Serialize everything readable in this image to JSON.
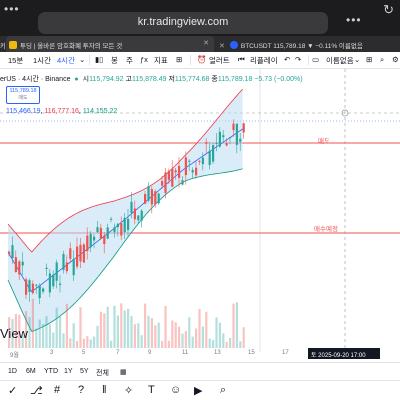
{
  "browser": {
    "url": "kr.tradingview.com",
    "tabs": [
      {
        "label": "카"
      },
      {
        "label": "투딩 | 올바른 암호화폐 투자의 모든 것"
      },
      {
        "label": "BTCUSDT 115,789.18 ▼ −0.11% 이름없음"
      }
    ]
  },
  "toolbar": {
    "intervals": [
      "15분",
      "1시간",
      "4시간"
    ],
    "chart_type": "봉",
    "extra": "주",
    "indicators": "지표",
    "alert": "얼러트",
    "replay": "리플레이",
    "layout_name": "이름없음"
  },
  "legend": {
    "symbol": "erUS · 4시간 · Binance",
    "open_label": "시",
    "open": "115,794.92",
    "high_label": "고",
    "high": "115,878.49",
    "low_label": "저",
    "low": "115,774.68",
    "close_label": "종",
    "close": "115,789.18",
    "change": "−5.73 (−0.00%)",
    "badge_price": "115,789.18",
    "badge_sub": "매도"
  },
  "bb_legend": {
    "basis": "115,466.19",
    "upper": "116,777.16",
    "lower": "114,155.22"
  },
  "annotations": {
    "sell_label": "매도",
    "buy_label": "매수예정"
  },
  "volume_label": "View",
  "x_axis": {
    "ticks": [
      "9월",
      "3",
      "5",
      "7",
      "9",
      "11",
      "13",
      "15",
      "17"
    ],
    "crosshair": "토  2025-09-20    17:00"
  },
  "timeframes": [
    "1D",
    "6M",
    "YTD",
    "1Y",
    "5Y",
    "전체"
  ],
  "drawing_tools": [
    "✓",
    "⎇",
    "#",
    "?",
    "‖",
    "✧",
    "T",
    "☺",
    "▶",
    "⌕"
  ],
  "colors": {
    "up": "#26a69a",
    "down": "#ef5350",
    "bb_upper": "#f23645",
    "bb_lower": "#089981",
    "bb_fill": "#bcdcf2",
    "accent": "#2962ff"
  }
}
